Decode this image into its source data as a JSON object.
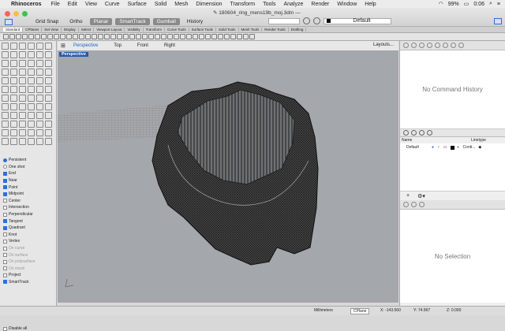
{
  "menubar": {
    "apple": "",
    "app": "Rhinoceros",
    "items": [
      "File",
      "Edit",
      "View",
      "Curve",
      "Surface",
      "Solid",
      "Mesh",
      "Dimension",
      "Transform",
      "Tools",
      "Analyze",
      "Render",
      "Window",
      "Help"
    ],
    "battery": "99%",
    "clock": "0:06"
  },
  "window": {
    "doc_title": "✎ 180604_ring_mens19b_moj.3dm —",
    "toggles": [
      {
        "label": "Grid Snap",
        "on": false
      },
      {
        "label": "Ortho",
        "on": false
      },
      {
        "label": "Planar",
        "on": true
      },
      {
        "label": "SmartTrack",
        "on": true
      },
      {
        "label": "Gumball",
        "on": true
      },
      {
        "label": "History",
        "on": false
      }
    ],
    "layer": "Default"
  },
  "toolbar_tabs": [
    "Standard",
    "CPlanes",
    "Set View",
    "Display",
    "Select",
    "Viewport Layout",
    "Visibility",
    "Transform",
    "Curve Tools",
    "Surface Tools",
    "Solid Tools",
    "Mesh Tools",
    "Render Tools",
    "Drafting"
  ],
  "osnap": {
    "persistent": "Persistent",
    "one_shot": "One shot",
    "items": [
      {
        "label": "End",
        "on": true,
        "dim": false
      },
      {
        "label": "Near",
        "on": true,
        "dim": false
      },
      {
        "label": "Point",
        "on": true,
        "dim": false
      },
      {
        "label": "Midpoint",
        "on": true,
        "dim": false
      },
      {
        "label": "Center",
        "on": false,
        "dim": false
      },
      {
        "label": "Intersection",
        "on": false,
        "dim": false
      },
      {
        "label": "Perpendicular",
        "on": false,
        "dim": false
      },
      {
        "label": "Tangent",
        "on": true,
        "dim": false
      },
      {
        "label": "Quadrant",
        "on": true,
        "dim": false
      },
      {
        "label": "Knot",
        "on": false,
        "dim": false
      },
      {
        "label": "Vertex",
        "on": false,
        "dim": false
      },
      {
        "label": "On curve",
        "on": false,
        "dim": true
      },
      {
        "label": "On surface",
        "on": false,
        "dim": true
      },
      {
        "label": "On polysurface",
        "on": false,
        "dim": true
      },
      {
        "label": "On mesh",
        "on": false,
        "dim": true
      },
      {
        "label": "Project",
        "on": false,
        "dim": false
      },
      {
        "label": "SmartTrack",
        "on": true,
        "dim": false
      }
    ],
    "disable_all": "Disable all"
  },
  "viewport": {
    "tabs": [
      "Perspective",
      "Top",
      "Front",
      "Right"
    ],
    "active_tab": "Perspective",
    "layouts": "Layouts...",
    "label": "Perspective"
  },
  "right_panel": {
    "command_history": "No Command History",
    "layers_headers": [
      "Name",
      "Linetype"
    ],
    "layer_row": {
      "name": "Default",
      "linetype": "Conti..."
    },
    "selection": "No Selection"
  },
  "statusbar": {
    "units": "Millimeters",
    "cplane": "CPlane",
    "x": "X: -143.560",
    "y": "Y: 74.967",
    "z": "Z: 0.000"
  }
}
